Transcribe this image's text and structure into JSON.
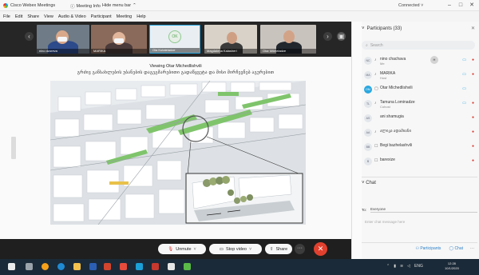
{
  "titlebar": {
    "app_title": "Cisco Webex Meetings",
    "meeting_info": "Meeting Info",
    "hide_menu_bar": "Hide menu bar",
    "connection": "Connected",
    "minimize": "–",
    "maximize": "□",
    "close": "✕"
  },
  "menu": [
    "File",
    "Edit",
    "Share",
    "View",
    "Audio & Video",
    "Participant",
    "Meeting",
    "Help"
  ],
  "video_strip": {
    "tiles": [
      {
        "name": "nino dzoreva"
      },
      {
        "name": "MARIKA"
      },
      {
        "name": "Ola Kutateladze"
      },
      {
        "name": "Magdalena Kalasheri"
      },
      {
        "name": "Otar Mikheladze"
      }
    ],
    "ok_avatar": "OK"
  },
  "shared": {
    "viewing": "Viewing Otar Michedlishvili",
    "slide_title": "გრძივ განსახლების უბანების დაგეგმარებითი გადაწყვეტა და მისი მირჩევნებ აგურებით"
  },
  "controls": {
    "unmute": "Unmute",
    "stop_video": "Stop video",
    "share": "Share",
    "more": "···",
    "end": "✕"
  },
  "panel": {
    "title": "Participants (33)",
    "search_placeholder": "Search",
    "participants": [
      {
        "initials": "NC",
        "name": "nino chachava",
        "role": "Me"
      },
      {
        "initials": "MA",
        "name": "MARIKA",
        "role": "Host"
      },
      {
        "initials": "OM",
        "name": "Otar Michedlishvili",
        "role": ""
      },
      {
        "initials": "TL",
        "name": "Tamuna Lominadze",
        "role": "Cohost"
      },
      {
        "initials": "AS",
        "name": "ani shamugia",
        "role": ""
      },
      {
        "initials": "AA",
        "name": "ალიკა ადამიანი",
        "role": ""
      },
      {
        "initials": "BB",
        "name": "Begi bazhelashvili",
        "role": ""
      },
      {
        "initials": "B",
        "name": "barexize",
        "role": ""
      }
    ],
    "host_badge": "H",
    "chat_title": "Chat",
    "to_label": "To:",
    "to_value": "Everyone",
    "chat_placeholder": "Enter chat message here",
    "tab_participants": "Participants",
    "tab_chat": "Chat",
    "tab_more": "···"
  },
  "taskbar": {
    "time": "12:28",
    "date": "10/1/2020",
    "lang": "ENG"
  }
}
